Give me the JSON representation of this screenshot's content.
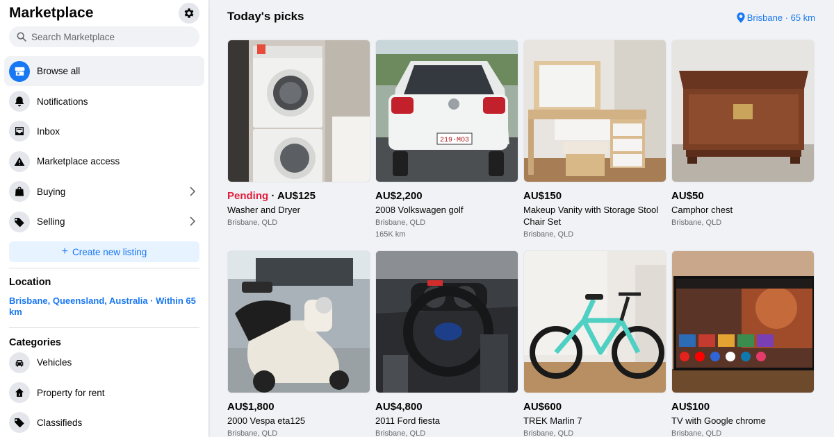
{
  "sidebar": {
    "title": "Marketplace",
    "search_placeholder": "Search Marketplace",
    "nav": [
      {
        "label": "Browse all",
        "icon": "storefront-icon",
        "active": true
      },
      {
        "label": "Notifications",
        "icon": "bell-icon"
      },
      {
        "label": "Inbox",
        "icon": "inbox-icon"
      },
      {
        "label": "Marketplace access",
        "icon": "warning-icon"
      },
      {
        "label": "Buying",
        "icon": "shopping-bag-icon",
        "chevron": true
      },
      {
        "label": "Selling",
        "icon": "price-tag-icon",
        "chevron": true
      }
    ],
    "create_label": "Create new listing",
    "location_heading": "Location",
    "location_value": "Brisbane, Queensland, Australia · Within 65 km",
    "categories_heading": "Categories",
    "categories": [
      {
        "label": "Vehicles",
        "icon": "car-icon"
      },
      {
        "label": "Property for rent",
        "icon": "house-icon"
      },
      {
        "label": "Classifieds",
        "icon": "tag-icon"
      }
    ]
  },
  "main": {
    "title": "Today's picks",
    "location_chip": "Brisbane · 65 km",
    "listings": [
      {
        "status": "Pending",
        "price": "AU$125",
        "title": "Washer and Dryer",
        "location": "Brisbane, QLD",
        "meta": ""
      },
      {
        "status": "",
        "price": "AU$2,200",
        "title": "2008 Volkswagen golf",
        "location": "Brisbane, QLD",
        "meta": "165K km"
      },
      {
        "status": "",
        "price": "AU$150",
        "title": "Makeup Vanity with Storage Stool Chair Set",
        "location": "Brisbane, QLD",
        "meta": ""
      },
      {
        "status": "",
        "price": "AU$50",
        "title": "Camphor chest",
        "location": "Brisbane, QLD",
        "meta": ""
      },
      {
        "status": "",
        "price": "AU$1,800",
        "title": "2000 Vespa eta125",
        "location": "Brisbane, QLD",
        "meta": ""
      },
      {
        "status": "",
        "price": "AU$4,800",
        "title": "2011 Ford fiesta",
        "location": "Brisbane, QLD",
        "meta": ""
      },
      {
        "status": "",
        "price": "AU$600",
        "title": "TREK Marlin 7",
        "location": "Brisbane, QLD",
        "meta": ""
      },
      {
        "status": "",
        "price": "AU$100",
        "title": "TV with Google chrome",
        "location": "Brisbane, QLD",
        "meta": ""
      }
    ]
  },
  "colors": {
    "accent": "#1877f2",
    "pending": "#e41e3f",
    "background": "#f0f2f5"
  }
}
